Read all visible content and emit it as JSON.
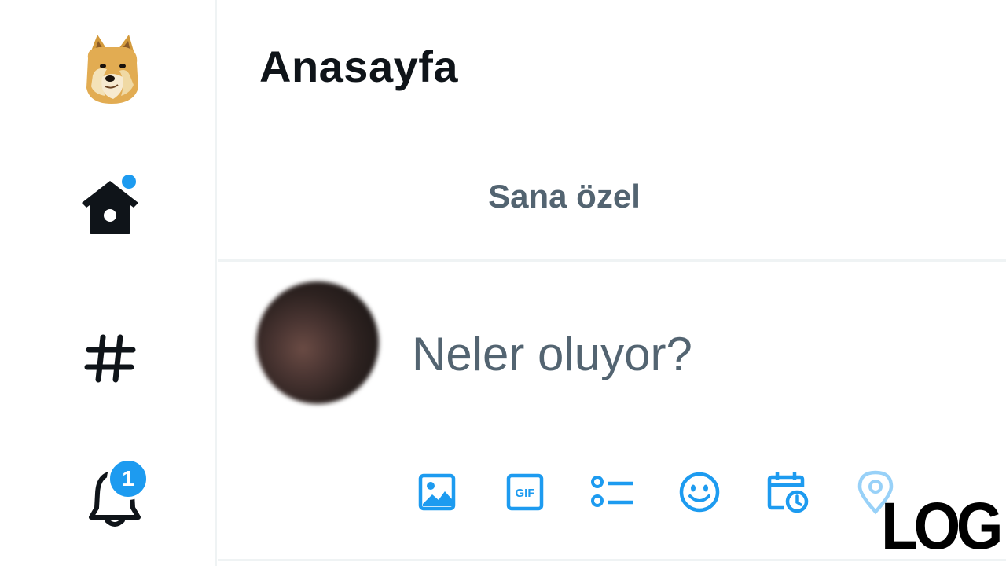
{
  "header": {
    "title": "Anasayfa"
  },
  "tabs": [
    {
      "label": "Sana özel"
    }
  ],
  "compose": {
    "placeholder": "Neler oluyor?"
  },
  "sidebar": {
    "items": [
      {
        "name": "profile-logo",
        "icon": "doge-logo"
      },
      {
        "name": "home",
        "icon": "home-icon",
        "badge": "dot"
      },
      {
        "name": "explore",
        "icon": "hashtag-icon"
      },
      {
        "name": "notifications",
        "icon": "bell-icon",
        "badge_count": "1"
      }
    ]
  },
  "toolbar": {
    "items": [
      {
        "icon": "image-icon"
      },
      {
        "icon": "gif-icon",
        "label": "GIF"
      },
      {
        "icon": "poll-icon"
      },
      {
        "icon": "emoji-icon"
      },
      {
        "icon": "schedule-icon"
      },
      {
        "icon": "location-icon"
      }
    ]
  },
  "watermark": {
    "text": "LOG"
  },
  "colors": {
    "accent": "#1d9bf0",
    "text_primary": "#0f1419",
    "text_secondary": "#536471",
    "border": "#eff3f4"
  }
}
